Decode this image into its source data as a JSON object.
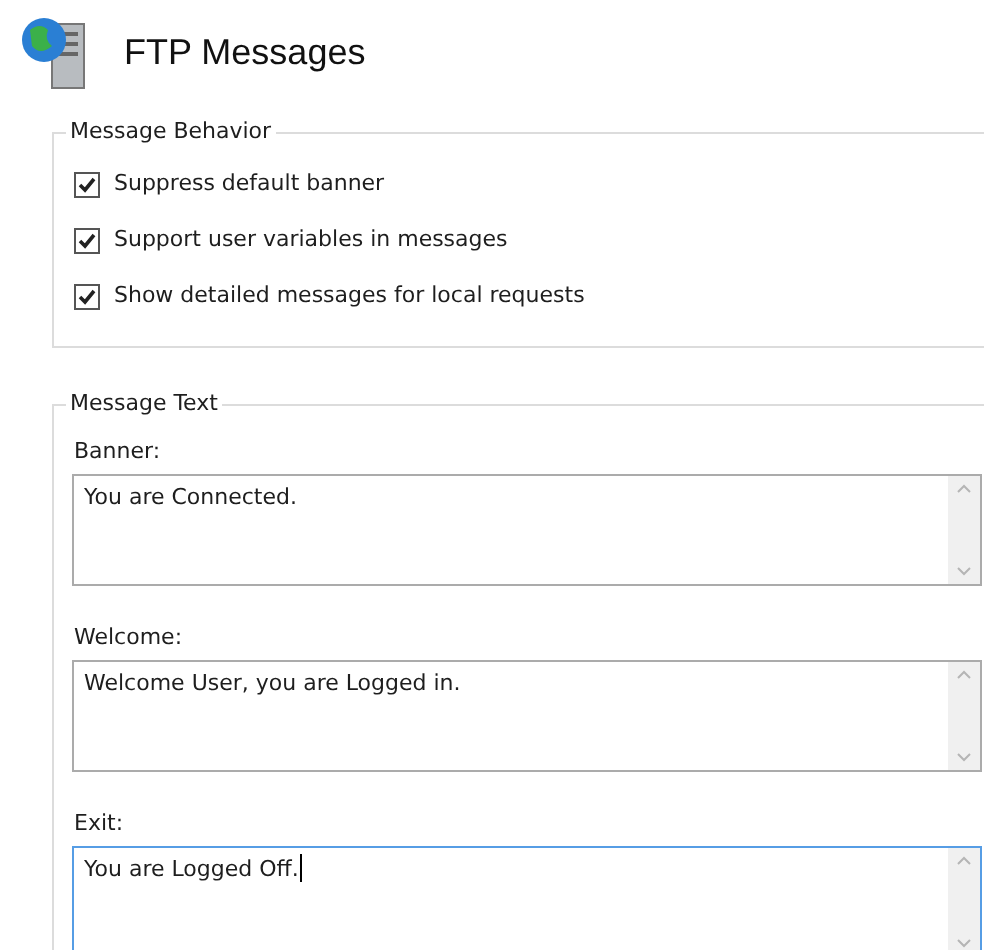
{
  "header": {
    "title": "FTP Messages"
  },
  "behavior": {
    "legend": "Message Behavior",
    "options": [
      {
        "label": "Suppress default banner",
        "checked": true
      },
      {
        "label": "Support user variables in messages",
        "checked": true
      },
      {
        "label": "Show detailed messages for local requests",
        "checked": true
      }
    ]
  },
  "message_text": {
    "legend": "Message Text",
    "fields": [
      {
        "label": "Banner:",
        "value": "You are Connected.",
        "focused": false
      },
      {
        "label": "Welcome:",
        "value": "Welcome User, you are Logged in.",
        "focused": false
      },
      {
        "label": "Exit:",
        "value": "You are Logged Off.",
        "focused": true
      }
    ]
  }
}
